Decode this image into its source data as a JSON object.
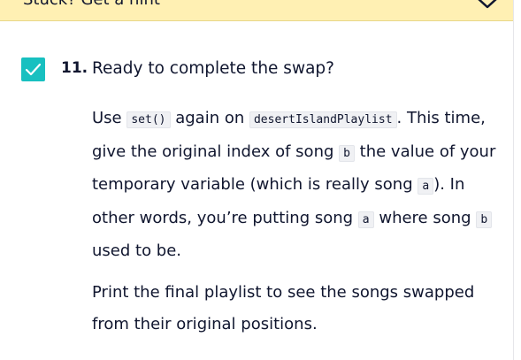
{
  "hint": {
    "label": "Stuck? Get a hint",
    "chevron_icon": "chevron-down-icon"
  },
  "task": {
    "checked": true,
    "checkbox_color": "#18c0c0",
    "number": "11.",
    "title": "Ready to complete the swap?",
    "instructions": {
      "t1": "Use ",
      "c1": "set()",
      "t2": " again on ",
      "c2": "desertIslandPlaylist",
      "t3": ". This time, give the original index of song ",
      "c3": "b",
      "t4": " the value of your temporary variable (which is really song ",
      "c4": "a",
      "t5": "). In other words, you’re putting song ",
      "c5": "a",
      "t6": " where song ",
      "c6": "b",
      "t7": " used to be."
    },
    "followup": "Print the final playlist to see the songs swapped from their original positions."
  }
}
